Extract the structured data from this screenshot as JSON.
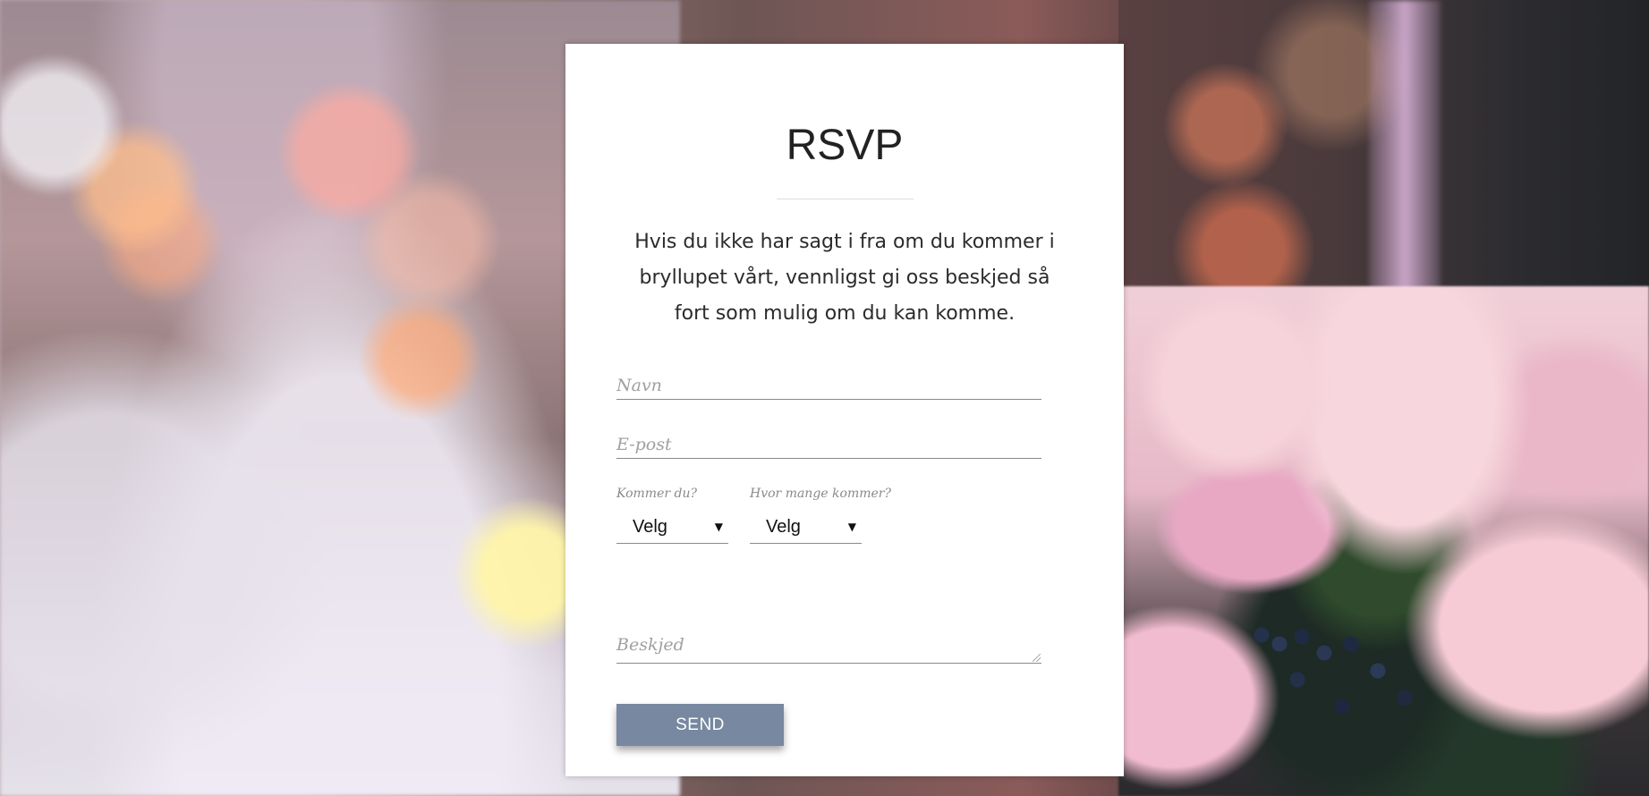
{
  "rsvp": {
    "title": "RSVP",
    "intro": "Hvis du ikke har sagt i fra om du kommer i bryllupet vårt, vennligst gi oss beskjed så fort som mulig om du kan komme.",
    "name_placeholder": "Navn",
    "email_placeholder": "E-post",
    "coming_label": "Kommer du?",
    "coming_value": "Velg",
    "howmany_label": "Hvor mange kommer?",
    "howmany_value": "Velg",
    "message_placeholder": "Beskjed",
    "send_label": "SEND"
  },
  "colors": {
    "button": "#7788a0",
    "card": "#ffffff",
    "text": "#222222"
  },
  "icons": {
    "dropdown": "chevron-down-icon",
    "resize": "resize-grip-icon"
  }
}
